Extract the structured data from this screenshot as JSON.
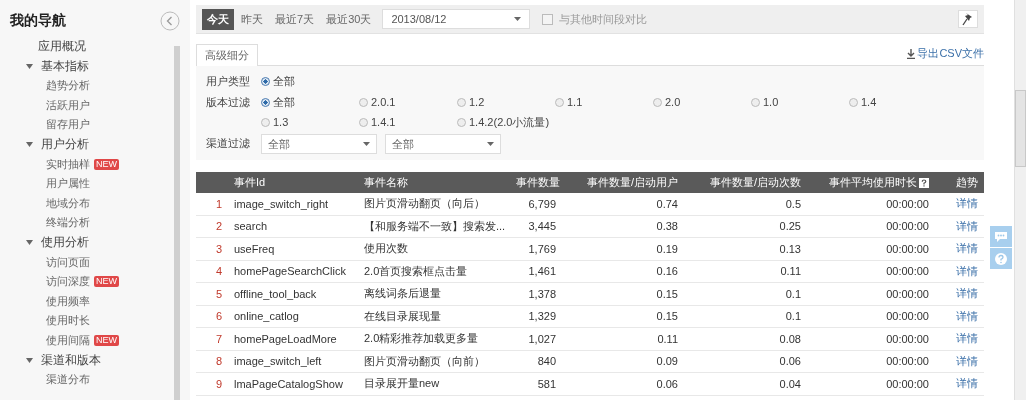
{
  "sidebar": {
    "title": "我的导航",
    "items": [
      {
        "label": "应用概况"
      },
      {
        "label": "基本指标",
        "expanded": true,
        "children": [
          {
            "label": "趋势分析"
          },
          {
            "label": "活跃用户"
          },
          {
            "label": "留存用户"
          }
        ]
      },
      {
        "label": "用户分析",
        "expanded": true,
        "children": [
          {
            "label": "实时抽样",
            "badge": "NEW"
          },
          {
            "label": "用户属性"
          },
          {
            "label": "地域分布"
          },
          {
            "label": "终端分析"
          }
        ]
      },
      {
        "label": "使用分析",
        "expanded": true,
        "children": [
          {
            "label": "访问页面"
          },
          {
            "label": "访问深度",
            "badge": "NEW"
          },
          {
            "label": "使用频率"
          },
          {
            "label": "使用时长"
          },
          {
            "label": "使用间隔",
            "badge": "NEW"
          }
        ]
      },
      {
        "label": "渠道和版本",
        "expanded": true,
        "children": [
          {
            "label": "渠道分布"
          }
        ]
      }
    ]
  },
  "toolbar": {
    "ranges": [
      {
        "label": "今天",
        "selected": true
      },
      {
        "label": "昨天",
        "selected": false
      },
      {
        "label": "最近7天",
        "selected": false
      },
      {
        "label": "最近30天",
        "selected": false
      }
    ],
    "date": "2013/08/12",
    "compare": {
      "label": "与其他时间段对比",
      "checked": false
    }
  },
  "tabs": [
    {
      "label": "高级细分",
      "selected": true
    }
  ],
  "export_link": "导出CSV文件",
  "filters": {
    "user_type": {
      "label": "用户类型",
      "options": [
        {
          "label": "全部",
          "selected": true
        }
      ]
    },
    "version": {
      "label": "版本过滤",
      "options": [
        {
          "label": "全部",
          "selected": true
        },
        {
          "label": "2.0.1",
          "selected": false
        },
        {
          "label": "1.2",
          "selected": false
        },
        {
          "label": "1.1",
          "selected": false
        },
        {
          "label": "2.0",
          "selected": false
        },
        {
          "label": "1.0",
          "selected": false
        },
        {
          "label": "1.4",
          "selected": false
        },
        {
          "label": "1.3",
          "selected": false
        },
        {
          "label": "1.4.1",
          "selected": false
        },
        {
          "label": "1.4.2(2.0小流量)",
          "selected": false
        }
      ]
    },
    "channel": {
      "label": "渠道过滤",
      "selects": [
        "全部",
        "全部"
      ]
    }
  },
  "table": {
    "columns": [
      {
        "label": "事件Id",
        "help": false
      },
      {
        "label": "事件名称",
        "help": false
      },
      {
        "label": "事件数量",
        "help": false
      },
      {
        "label": "事件数量/启动用户",
        "help": false
      },
      {
        "label": "事件数量/启动次数",
        "help": false
      },
      {
        "label": "事件平均使用时长",
        "help": true
      },
      {
        "label": "趋势",
        "help": false
      }
    ],
    "rows": [
      {
        "index": "1",
        "id": "image_switch_right",
        "name": "图片页滑动翻页（向后）",
        "count": "6,799",
        "per_user": "0.74",
        "per_launch": "0.5",
        "duration": "00:00:00",
        "trend": "详情"
      },
      {
        "index": "2",
        "id": "search",
        "name": "【和服务端不一致】搜索发...",
        "count": "3,445",
        "per_user": "0.38",
        "per_launch": "0.25",
        "duration": "00:00:00",
        "trend": "详情"
      },
      {
        "index": "3",
        "id": "useFreq",
        "name": "使用次数",
        "count": "1,769",
        "per_user": "0.19",
        "per_launch": "0.13",
        "duration": "00:00:00",
        "trend": "详情"
      },
      {
        "index": "4",
        "id": "homePageSearchClick",
        "name": "2.0首页搜索框点击量",
        "count": "1,461",
        "per_user": "0.16",
        "per_launch": "0.11",
        "duration": "00:00:00",
        "trend": "详情"
      },
      {
        "index": "5",
        "id": "offline_tool_back",
        "name": "离线词条后退量",
        "count": "1,378",
        "per_user": "0.15",
        "per_launch": "0.1",
        "duration": "00:00:00",
        "trend": "详情"
      },
      {
        "index": "6",
        "id": "online_catlog",
        "name": "在线目录展现量",
        "count": "1,329",
        "per_user": "0.15",
        "per_launch": "0.1",
        "duration": "00:00:00",
        "trend": "详情"
      },
      {
        "index": "7",
        "id": "homePageLoadMore",
        "name": "2.0精彩推荐加载更多量",
        "count": "1,027",
        "per_user": "0.11",
        "per_launch": "0.08",
        "duration": "00:00:00",
        "trend": "详情"
      },
      {
        "index": "8",
        "id": "image_switch_left",
        "name": "图片页滑动翻页（向前）",
        "count": "840",
        "per_user": "0.09",
        "per_launch": "0.06",
        "duration": "00:00:00",
        "trend": "详情"
      },
      {
        "index": "9",
        "id": "lmaPageCatalogShow",
        "name": "目录展开量new",
        "count": "581",
        "per_user": "0.06",
        "per_launch": "0.04",
        "duration": "00:00:00",
        "trend": "详情"
      }
    ]
  }
}
